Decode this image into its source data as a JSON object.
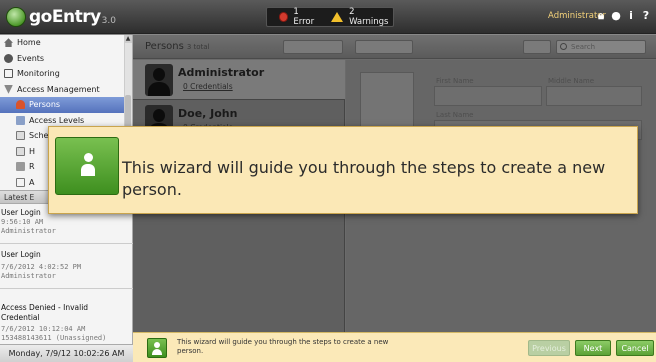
{
  "app": {
    "logo_text": "goEntry",
    "logo_version": "3.0"
  },
  "alerts": {
    "errors": "1 Error",
    "warnings": "2 Warnings"
  },
  "user": {
    "name": "Administrator"
  },
  "sidebar": {
    "items": [
      {
        "label": "Home",
        "icon": "home-icon"
      },
      {
        "label": "Events",
        "icon": "events-icon"
      },
      {
        "label": "Monitoring",
        "icon": "monitor-icon"
      },
      {
        "label": "Access Management",
        "icon": "access-management-icon"
      },
      {
        "label": "Persons",
        "icon": "person-icon"
      },
      {
        "label": "Access Levels",
        "icon": "access-levels-icon"
      },
      {
        "label": "Schedules",
        "icon": "schedule-icon"
      },
      {
        "label": "H",
        "icon": "holidays-icon"
      },
      {
        "label": "R",
        "icon": "readers-icon"
      },
      {
        "label": "A",
        "icon": "areas-icon"
      }
    ],
    "events_header": "Latest E",
    "events": [
      {
        "title": "User Login",
        "lines": [
          "9:56:10 AM",
          "Administrator"
        ]
      },
      {
        "title": "User Login",
        "lines": [
          "7/6/2012 4:02:52 PM",
          "Administrator"
        ]
      },
      {
        "title": "Access Denied - Invalid Credential",
        "lines": [
          "7/6/2012 10:12:04 AM",
          "153488143611 (Unassigned)"
        ]
      }
    ],
    "datetime": "Monday, 7/9/12 10:02:26 AM"
  },
  "persons": {
    "title": "Persons",
    "count": "3 total",
    "search_placeholder": "Search",
    "list": [
      {
        "name": "Administrator",
        "credentials": "0 Credentials"
      },
      {
        "name": "Doe, John",
        "credentials": "0 Credentials"
      }
    ]
  },
  "detail": {
    "first_name_label": "First Name",
    "middle_name_label": "Middle Name",
    "last_name_label": "Last Name"
  },
  "wizard": {
    "popup_text": "This wizard will guide you through the steps to create a new person.",
    "bar_text": "This wizard will guide you through the steps to create a new person.",
    "previous_label": "Previous",
    "next_label": "Next",
    "cancel_label": "Cancel"
  }
}
